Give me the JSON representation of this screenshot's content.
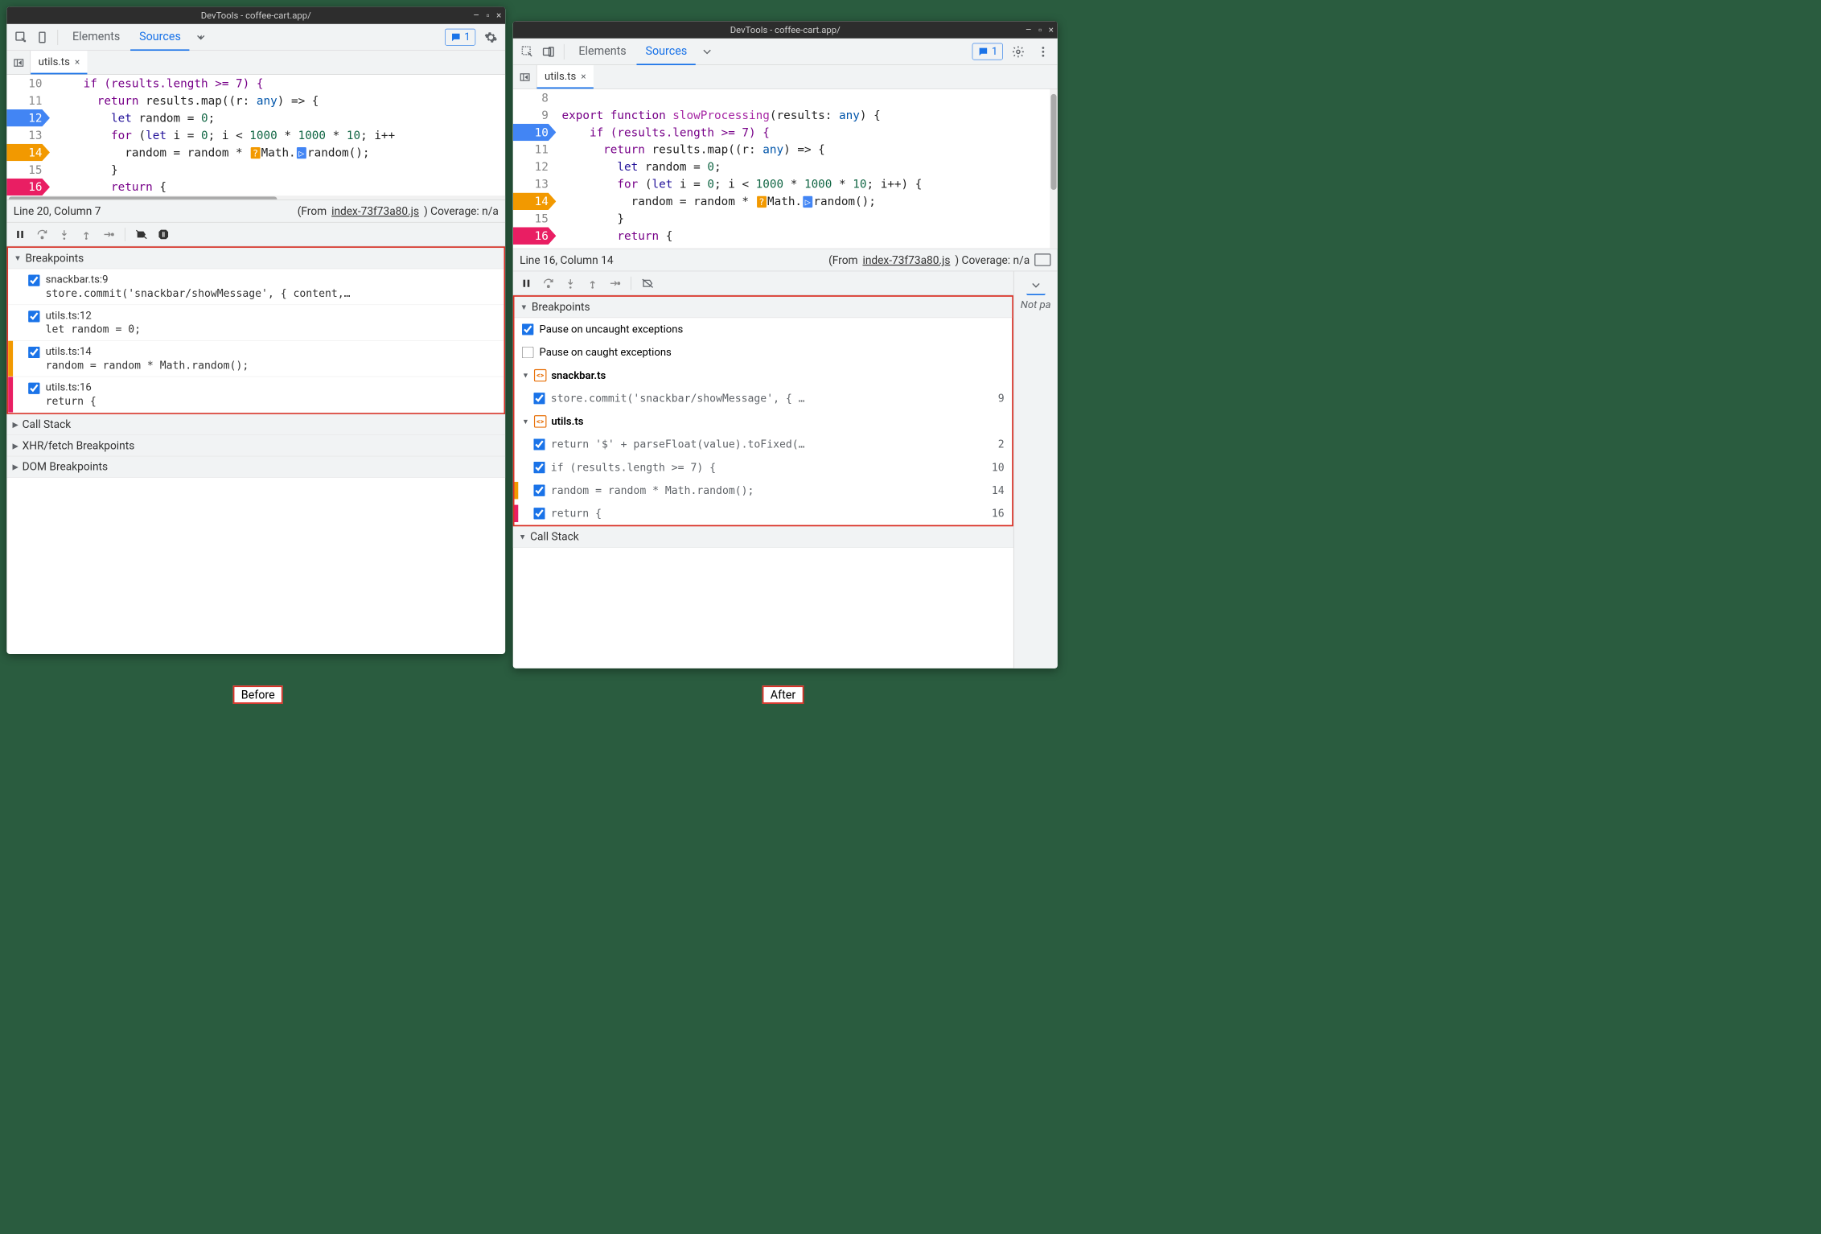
{
  "titlebar": "DevTools - coffee-cart.app/",
  "tabs": {
    "elements": "Elements",
    "sources": "Sources"
  },
  "msgCount": "1",
  "file": "utils.ts",
  "before": {
    "status": {
      "pos": "Line 20, Column 7",
      "from": "(From ",
      "link": "index-73f73a80.js",
      "rest": ")  Coverage: n/a"
    },
    "code": {
      "l10": "if (results.length >= 7) {",
      "l11a": "return",
      "l11b": " results.map((r: ",
      "l11c": "any",
      "l11d": ") => {",
      "l12a": "let",
      "l12b": " random = ",
      "l12c": "0",
      "l12d": ";",
      "l13a": "for",
      "l13b": " (",
      "l13c": "let",
      "l13d": " i = ",
      "l13e": "0",
      "l13f": "; i < ",
      "l13g": "1000",
      "l13h": " * ",
      "l13i": "1000",
      "l13j": " * ",
      "l13k": "10",
      "l13l": "; i++",
      "l14": "random = random * ",
      "l14b": "Math.",
      "l14c": "random();",
      "l15": "}",
      "l16": "return",
      "l16b": " {"
    },
    "lines": {
      "l10": "10",
      "l11": "11",
      "l12": "12",
      "l13": "13",
      "l14": "14",
      "l15": "15",
      "l16": "16"
    },
    "badge14": "?",
    "badge16": "‥",
    "sections": {
      "bp": "Breakpoints",
      "cs": "Call Stack",
      "xhr": "XHR/fetch Breakpoints",
      "dom": "DOM Breakpoints"
    },
    "bps": [
      {
        "title": "snackbar.ts:9",
        "code": "store.commit('snackbar/showMessage', { content,…"
      },
      {
        "title": "utils.ts:12",
        "code": "let random = 0;"
      },
      {
        "title": "utils.ts:14",
        "code": "random = random * Math.random();",
        "edge": "#f29900"
      },
      {
        "title": "utils.ts:16",
        "code": "return {",
        "edge": "#e91e63"
      }
    ]
  },
  "after": {
    "status": {
      "pos": "Line 16, Column 14",
      "from": "(From ",
      "link": "index-73f73a80.js",
      "rest": ")  Coverage: n/a"
    },
    "code": {
      "l9a": "export function",
      "l9b": " slowProcessing",
      "l9c": "(results: ",
      "l9d": "any",
      "l9e": ") {",
      "l10": "if (results.length >= 7) {",
      "l11a": "return",
      "l11b": " results.map((r: ",
      "l11c": "any",
      "l11d": ") => {",
      "l12a": "let",
      "l12b": " random = ",
      "l12c": "0",
      "l12d": ";",
      "l13a": "for",
      "l13b": " (",
      "l13c": "let",
      "l13d": " i = ",
      "l13e": "0",
      "l13f": "; i < ",
      "l13g": "1000",
      "l13h": " * ",
      "l13i": "1000",
      "l13j": " * ",
      "l13k": "10",
      "l13l": "; i++) {",
      "l14": "random = random * ",
      "l14b": "Math.",
      "l14c": "random();",
      "l15": "}",
      "l16": "return",
      "l16b": " {"
    },
    "lines": {
      "l8": "8",
      "l9": "9",
      "l10": "10",
      "l11": "11",
      "l12": "12",
      "l13": "13",
      "l14": "14",
      "l15": "15",
      "l16": "16"
    },
    "badge14": "?",
    "badge16": "‥",
    "sections": {
      "bp": "Breakpoints",
      "cs": "Call Stack"
    },
    "pauseUncaught": "Pause on uncaught exceptions",
    "pauseCaught": "Pause on caught exceptions",
    "notPaused": "Not pa",
    "groups": [
      {
        "name": "snackbar.ts",
        "items": [
          {
            "code": "store.commit('snackbar/showMessage', { …",
            "ln": "9"
          }
        ]
      },
      {
        "name": "utils.ts",
        "items": [
          {
            "code": "return '$' + parseFloat(value).toFixed(…",
            "ln": "2"
          },
          {
            "code": "if (results.length >= 7) {",
            "ln": "10"
          },
          {
            "code": "random = random * Math.random();",
            "ln": "14",
            "edge": "#f29900"
          },
          {
            "code": "return {",
            "ln": "16",
            "edge": "#e91e63"
          }
        ]
      }
    ]
  },
  "labels": {
    "before": "Before",
    "after": "After"
  }
}
